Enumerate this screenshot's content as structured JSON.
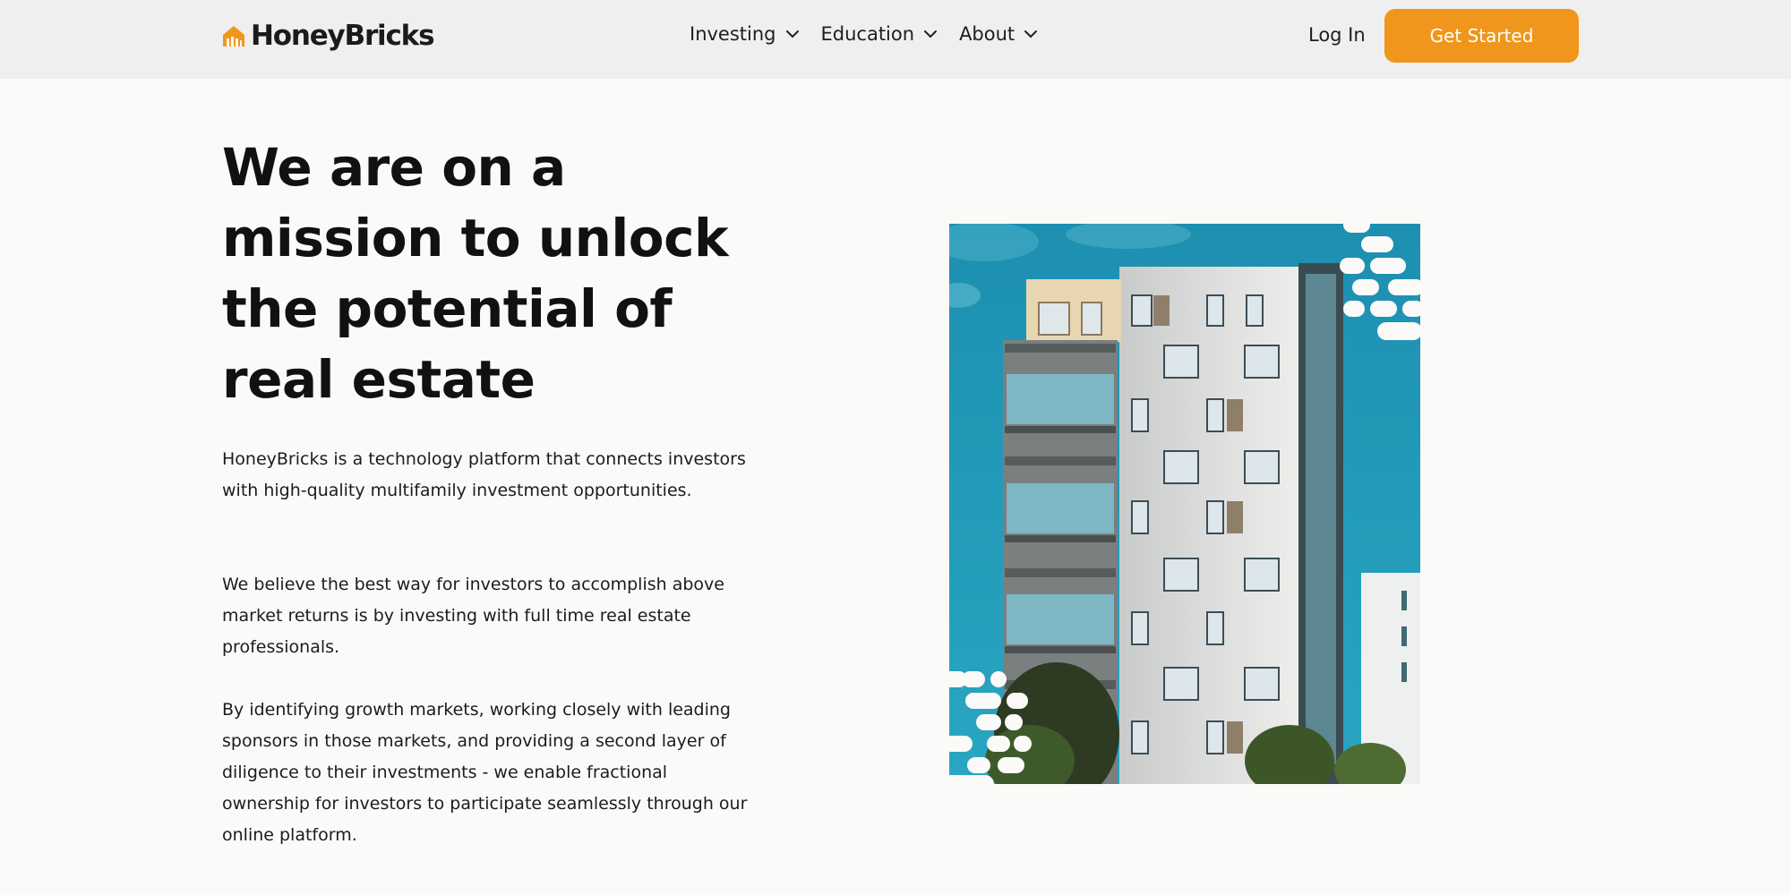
{
  "header": {
    "logo_text": "HoneyBricks",
    "logo_icon": "house-bricks-icon",
    "nav": [
      {
        "label": "Investing",
        "icon": "chevron-down-icon"
      },
      {
        "label": "Education",
        "icon": "chevron-down-icon"
      },
      {
        "label": "About",
        "icon": "chevron-down-icon"
      }
    ],
    "login_label": "Log In",
    "cta_label": "Get Started"
  },
  "hero": {
    "title": "We are on a mission to unlock the potential of real estate",
    "paragraphs": [
      "HoneyBricks is a technology platform that connects investors with high-quality multifamily investment opportunities.",
      "We believe the best way for investors to accomplish above market returns is by investing with full time real estate professionals.",
      "By identifying growth markets, working closely with leading sponsors in those markets, and providing a second layer of diligence to their investments - we enable fractional ownership for investors to participate seamlessly through our online platform."
    ],
    "image": "apartment-building-photo"
  },
  "colors": {
    "accent": "#f0961c",
    "header_bg": "#efefef",
    "page_bg": "#fbfaf8",
    "sky": "#1e98b6"
  }
}
